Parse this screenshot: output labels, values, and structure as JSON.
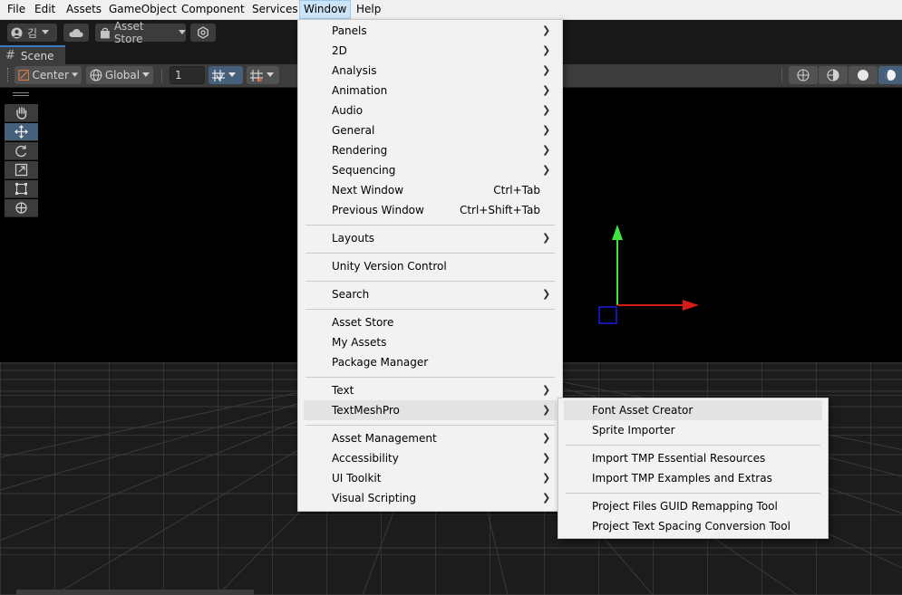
{
  "menubar": {
    "items": [
      "File",
      "Edit",
      "Assets",
      "GameObject",
      "Component",
      "Services",
      "Window",
      "Help"
    ],
    "active": "Window"
  },
  "toolbar": {
    "account_label": "김",
    "asset_store_label": "Asset Store"
  },
  "scene_tab": {
    "label": "Scene"
  },
  "scene_toolbar": {
    "pivot_label": "Center",
    "space_label": "Global",
    "snap_value": "1"
  },
  "window_menu": {
    "items": [
      {
        "label": "Panels",
        "submenu": true
      },
      {
        "label": "2D",
        "submenu": true
      },
      {
        "label": "Analysis",
        "submenu": true
      },
      {
        "label": "Animation",
        "submenu": true
      },
      {
        "label": "Audio",
        "submenu": true
      },
      {
        "label": "General",
        "submenu": true
      },
      {
        "label": "Rendering",
        "submenu": true
      },
      {
        "label": "Sequencing",
        "submenu": true
      },
      {
        "label": "Next Window",
        "shortcut": "Ctrl+Tab"
      },
      {
        "label": "Previous Window",
        "shortcut": "Ctrl+Shift+Tab"
      },
      {
        "label": "Layouts",
        "submenu": true
      },
      {
        "label": "Unity Version Control"
      },
      {
        "label": "Search",
        "submenu": true
      },
      {
        "label": "Asset Store"
      },
      {
        "label": "My Assets"
      },
      {
        "label": "Package Manager"
      },
      {
        "label": "Text",
        "submenu": true
      },
      {
        "label": "TextMeshPro",
        "submenu": true,
        "highlighted": true
      },
      {
        "label": "Asset Management",
        "submenu": true
      },
      {
        "label": "Accessibility",
        "submenu": true
      },
      {
        "label": "UI Toolkit",
        "submenu": true
      },
      {
        "label": "Visual Scripting",
        "submenu": true
      }
    ]
  },
  "textmeshpro_submenu": {
    "items": [
      {
        "label": "Font Asset Creator",
        "highlighted": true
      },
      {
        "label": "Sprite Importer"
      },
      {
        "label": "Import TMP Essential Resources"
      },
      {
        "label": "Import TMP Examples and Extras"
      },
      {
        "label": "Project Files GUID Remapping Tool"
      },
      {
        "label": "Project Text Spacing Conversion Tool"
      }
    ]
  },
  "icons": {
    "arrow": "chevron-right-icon",
    "tools": [
      "hand-icon",
      "move-icon",
      "rotate-icon",
      "scale-icon",
      "rect-icon",
      "transform-icon"
    ]
  },
  "colors": {
    "gizmo_y": "#3fe53f",
    "gizmo_x": "#d51a1a",
    "gizmo_z": "#1a1ad5",
    "menu_bg": "#f2f2f2",
    "highlight": "#e3e3e3",
    "active_tool": "#46607c"
  }
}
